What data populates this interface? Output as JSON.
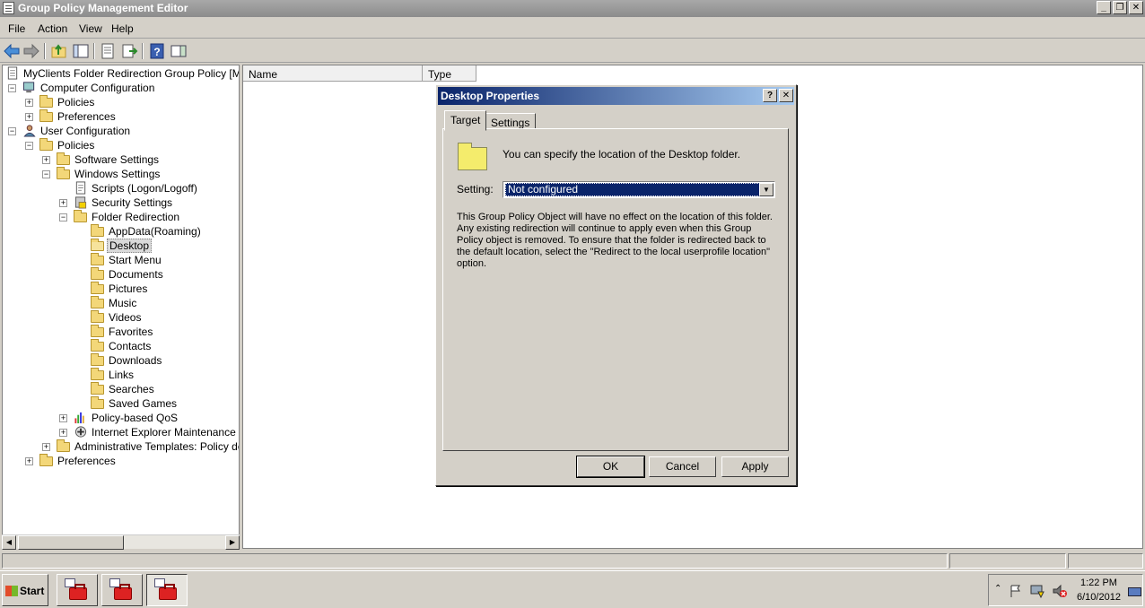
{
  "window": {
    "title": "Group Policy Management Editor"
  },
  "menu": [
    "File",
    "Action",
    "View",
    "Help"
  ],
  "tree": {
    "root": "MyClients Folder Redirection Group Policy [MYDC.F",
    "items": [
      {
        "label": "Computer Configuration",
        "level": 0,
        "expand": "minus",
        "icon": "computer-icon"
      },
      {
        "label": "Policies",
        "level": 1,
        "expand": "plus",
        "icon": "folder-icon"
      },
      {
        "label": "Preferences",
        "level": 1,
        "expand": "plus",
        "icon": "folder-icon"
      },
      {
        "label": "User Configuration",
        "level": 0,
        "expand": "minus",
        "icon": "user-icon"
      },
      {
        "label": "Policies",
        "level": 1,
        "expand": "minus",
        "icon": "folder-icon"
      },
      {
        "label": "Software Settings",
        "level": 2,
        "expand": "plus",
        "icon": "folder-icon"
      },
      {
        "label": "Windows Settings",
        "level": 2,
        "expand": "minus",
        "icon": "folder-icon"
      },
      {
        "label": "Scripts (Logon/Logoff)",
        "level": 3,
        "expand": "",
        "icon": "script-icon"
      },
      {
        "label": "Security Settings",
        "level": 3,
        "expand": "plus",
        "icon": "security-icon"
      },
      {
        "label": "Folder Redirection",
        "level": 3,
        "expand": "minus",
        "icon": "folder-icon"
      },
      {
        "label": "AppData(Roaming)",
        "level": 4,
        "expand": "",
        "icon": "folder-icon"
      },
      {
        "label": "Desktop",
        "level": 4,
        "expand": "",
        "icon": "open-folder-icon",
        "selected": true
      },
      {
        "label": "Start Menu",
        "level": 4,
        "expand": "",
        "icon": "folder-icon"
      },
      {
        "label": "Documents",
        "level": 4,
        "expand": "",
        "icon": "folder-icon"
      },
      {
        "label": "Pictures",
        "level": 4,
        "expand": "",
        "icon": "folder-icon"
      },
      {
        "label": "Music",
        "level": 4,
        "expand": "",
        "icon": "folder-icon"
      },
      {
        "label": "Videos",
        "level": 4,
        "expand": "",
        "icon": "folder-icon"
      },
      {
        "label": "Favorites",
        "level": 4,
        "expand": "",
        "icon": "folder-icon"
      },
      {
        "label": "Contacts",
        "level": 4,
        "expand": "",
        "icon": "folder-icon"
      },
      {
        "label": "Downloads",
        "level": 4,
        "expand": "",
        "icon": "folder-icon"
      },
      {
        "label": "Links",
        "level": 4,
        "expand": "",
        "icon": "folder-icon"
      },
      {
        "label": "Searches",
        "level": 4,
        "expand": "",
        "icon": "folder-icon"
      },
      {
        "label": "Saved Games",
        "level": 4,
        "expand": "",
        "icon": "folder-icon"
      },
      {
        "label": "Policy-based QoS",
        "level": 3,
        "expand": "plus",
        "icon": "chart-icon"
      },
      {
        "label": "Internet Explorer Maintenance",
        "level": 3,
        "expand": "plus",
        "icon": "ie-maintenance-icon"
      },
      {
        "label": "Administrative Templates: Policy defini",
        "level": 2,
        "expand": "plus",
        "icon": "folder-icon"
      },
      {
        "label": "Preferences",
        "level": 1,
        "expand": "plus",
        "icon": "folder-icon"
      }
    ]
  },
  "list": {
    "columns": [
      "Name",
      "Type"
    ]
  },
  "dialog": {
    "title": "Desktop Properties",
    "help": "?",
    "tabs": [
      "Target",
      "Settings"
    ],
    "info": "You can specify the location of the Desktop folder.",
    "setting_label": "Setting:",
    "setting_value": "Not configured",
    "description": "This Group Policy Object will have no effect on the location of this folder. Any existing redirection will continue to apply even when this Group Policy object is removed. To ensure that the folder is redirected back to the default location, select the \"Redirect to the local userprofile location\" option.",
    "buttons": {
      "ok": "OK",
      "cancel": "Cancel",
      "apply": "Apply"
    }
  },
  "taskbar": {
    "start": "Start",
    "time": "1:22 PM",
    "date": "6/10/2012"
  }
}
